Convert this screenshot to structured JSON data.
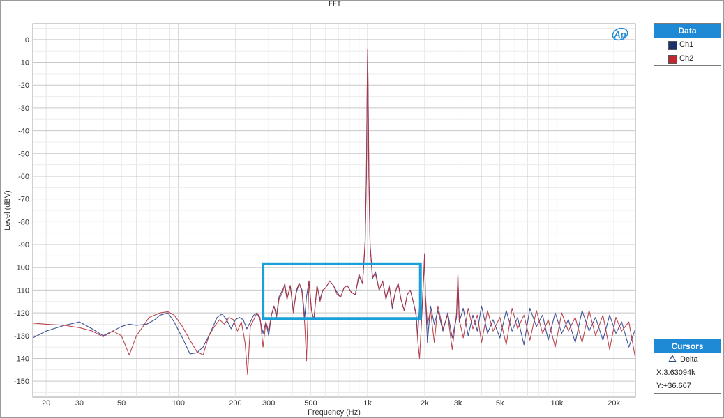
{
  "chart_data": {
    "type": "line",
    "title": "FFT",
    "xlabel": "Frequency (Hz)",
    "ylabel": "Level (dBV)",
    "xscale": "log",
    "xlim": [
      17,
      26000
    ],
    "ylim": [
      -157,
      7
    ],
    "grid": true,
    "x_tick_labels": [
      "20",
      "30",
      "50",
      "100",
      "200",
      "300",
      "500",
      "1k",
      "2k",
      "3k",
      "5k",
      "10k",
      "20k"
    ],
    "x_tick_values": [
      20,
      30,
      50,
      100,
      200,
      300,
      500,
      1000,
      2000,
      3000,
      5000,
      10000,
      20000
    ],
    "y_tick_values": [
      0,
      -10,
      -20,
      -30,
      -40,
      -50,
      -60,
      -70,
      -80,
      -90,
      -100,
      -110,
      -120,
      -130,
      -140,
      -150
    ],
    "series": [
      {
        "name": "Ch1",
        "color": "#2b3f8c",
        "points": [
          [
            17,
            -131
          ],
          [
            20,
            -128
          ],
          [
            25,
            -125.5
          ],
          [
            30,
            -124
          ],
          [
            35,
            -127
          ],
          [
            40,
            -130
          ],
          [
            45,
            -128
          ],
          [
            50,
            -126
          ],
          [
            55,
            -125
          ],
          [
            60,
            -125.5
          ],
          [
            68,
            -125
          ],
          [
            75,
            -123
          ],
          [
            80,
            -121
          ],
          [
            88,
            -120
          ],
          [
            95,
            -124
          ],
          [
            105,
            -131
          ],
          [
            115,
            -138
          ],
          [
            125,
            -137.5
          ],
          [
            135,
            -135
          ],
          [
            145,
            -130
          ],
          [
            160,
            -122
          ],
          [
            170,
            -120.5
          ],
          [
            180,
            -123
          ],
          [
            190,
            -127
          ],
          [
            200,
            -123
          ],
          [
            210,
            -122
          ],
          [
            220,
            -123
          ],
          [
            230,
            -127
          ],
          [
            240,
            -124
          ],
          [
            250,
            -121
          ],
          [
            260,
            -120
          ],
          [
            270,
            -123
          ],
          [
            280,
            -129
          ],
          [
            290,
            -124
          ],
          [
            300,
            -130
          ],
          [
            310,
            -121
          ],
          [
            320,
            -117
          ],
          [
            330,
            -121
          ],
          [
            340,
            -113
          ],
          [
            355,
            -110
          ],
          [
            365,
            -108
          ],
          [
            375,
            -114
          ],
          [
            390,
            -108
          ],
          [
            405,
            -119
          ],
          [
            420,
            -111
          ],
          [
            435,
            -107
          ],
          [
            450,
            -110
          ],
          [
            465,
            -122
          ],
          [
            475,
            -113
          ],
          [
            490,
            -106
          ],
          [
            505,
            -119
          ],
          [
            520,
            -123
          ],
          [
            540,
            -108
          ],
          [
            560,
            -114
          ],
          [
            580,
            -110
          ],
          [
            600,
            -109
          ],
          [
            630,
            -106
          ],
          [
            660,
            -108
          ],
          [
            690,
            -111
          ],
          [
            720,
            -113
          ],
          [
            750,
            -109
          ],
          [
            780,
            -108
          ],
          [
            820,
            -111
          ],
          [
            860,
            -112
          ],
          [
            900,
            -104
          ],
          [
            940,
            -107
          ],
          [
            970,
            -90
          ],
          [
            985,
            -60
          ],
          [
            995,
            -20
          ],
          [
            1000,
            -4.5
          ],
          [
            1005,
            -20
          ],
          [
            1015,
            -60
          ],
          [
            1030,
            -90
          ],
          [
            1060,
            -105
          ],
          [
            1100,
            -102
          ],
          [
            1150,
            -110
          ],
          [
            1200,
            -106
          ],
          [
            1250,
            -114
          ],
          [
            1300,
            -108
          ],
          [
            1350,
            -118
          ],
          [
            1400,
            -111
          ],
          [
            1450,
            -107
          ],
          [
            1500,
            -114
          ],
          [
            1560,
            -119
          ],
          [
            1620,
            -112
          ],
          [
            1680,
            -110
          ],
          [
            1740,
            -115
          ],
          [
            1800,
            -120
          ],
          [
            1840,
            -130
          ],
          [
            1880,
            -117
          ],
          [
            1920,
            -125
          ],
          [
            1980,
            -103
          ],
          [
            2000,
            -94
          ],
          [
            2020,
            -112
          ],
          [
            2070,
            -133
          ],
          [
            2150,
            -117
          ],
          [
            2250,
            -125
          ],
          [
            2350,
            -119
          ],
          [
            2500,
            -128
          ],
          [
            2650,
            -120
          ],
          [
            2800,
            -131
          ],
          [
            2950,
            -122
          ],
          [
            3000,
            -104
          ],
          [
            3050,
            -124
          ],
          [
            3200,
            -118
          ],
          [
            3400,
            -130
          ],
          [
            3600,
            -121
          ],
          [
            3800,
            -128
          ],
          [
            4000,
            -117
          ],
          [
            4300,
            -129
          ],
          [
            4600,
            -123
          ],
          [
            5000,
            -131
          ],
          [
            5400,
            -119
          ],
          [
            5800,
            -128
          ],
          [
            6200,
            -122
          ],
          [
            6700,
            -134
          ],
          [
            7200,
            -118
          ],
          [
            7800,
            -126
          ],
          [
            8400,
            -121
          ],
          [
            9000,
            -132
          ],
          [
            9800,
            -120
          ],
          [
            10600,
            -129
          ],
          [
            11500,
            -123
          ],
          [
            12500,
            -133
          ],
          [
            13600,
            -119
          ],
          [
            14800,
            -128
          ],
          [
            16000,
            -122
          ],
          [
            17500,
            -132
          ],
          [
            19000,
            -121
          ],
          [
            20500,
            -129
          ],
          [
            22000,
            -124
          ],
          [
            24000,
            -135
          ],
          [
            26000,
            -127
          ]
        ]
      },
      {
        "name": "Ch2",
        "color": "#b5323c",
        "points": [
          [
            17,
            -124.5
          ],
          [
            20,
            -125
          ],
          [
            25,
            -125.5
          ],
          [
            30,
            -126.5
          ],
          [
            35,
            -128
          ],
          [
            40,
            -130.5
          ],
          [
            45,
            -128
          ],
          [
            50,
            -130
          ],
          [
            55,
            -138.5
          ],
          [
            60,
            -130
          ],
          [
            65,
            -126
          ],
          [
            70,
            -122
          ],
          [
            75,
            -121
          ],
          [
            80,
            -120
          ],
          [
            88,
            -119.5
          ],
          [
            95,
            -121
          ],
          [
            105,
            -126
          ],
          [
            115,
            -132
          ],
          [
            125,
            -137
          ],
          [
            135,
            -138.5
          ],
          [
            145,
            -130
          ],
          [
            155,
            -126
          ],
          [
            165,
            -123
          ],
          [
            175,
            -125
          ],
          [
            185,
            -122
          ],
          [
            195,
            -123
          ],
          [
            205,
            -128
          ],
          [
            215,
            -124
          ],
          [
            225,
            -133
          ],
          [
            232,
            -147
          ],
          [
            240,
            -126
          ],
          [
            250,
            -123
          ],
          [
            260,
            -120
          ],
          [
            270,
            -122
          ],
          [
            280,
            -135
          ],
          [
            290,
            -124
          ],
          [
            300,
            -128
          ],
          [
            310,
            -121
          ],
          [
            320,
            -117
          ],
          [
            330,
            -122
          ],
          [
            340,
            -114
          ],
          [
            355,
            -111
          ],
          [
            365,
            -107
          ],
          [
            375,
            -114
          ],
          [
            390,
            -108
          ],
          [
            405,
            -120
          ],
          [
            420,
            -110
          ],
          [
            435,
            -107
          ],
          [
            450,
            -111
          ],
          [
            465,
            -125
          ],
          [
            475,
            -141
          ],
          [
            490,
            -106
          ],
          [
            505,
            -119
          ],
          [
            520,
            -123
          ],
          [
            540,
            -108
          ],
          [
            560,
            -115
          ],
          [
            580,
            -110
          ],
          [
            600,
            -109
          ],
          [
            630,
            -106
          ],
          [
            660,
            -108
          ],
          [
            690,
            -112
          ],
          [
            720,
            -113
          ],
          [
            750,
            -109
          ],
          [
            780,
            -108
          ],
          [
            820,
            -111
          ],
          [
            860,
            -112
          ],
          [
            900,
            -103
          ],
          [
            940,
            -107
          ],
          [
            970,
            -88
          ],
          [
            985,
            -60
          ],
          [
            995,
            -20
          ],
          [
            1000,
            -4.5
          ],
          [
            1005,
            -20
          ],
          [
            1015,
            -60
          ],
          [
            1030,
            -90
          ],
          [
            1060,
            -104
          ],
          [
            1100,
            -103
          ],
          [
            1150,
            -110
          ],
          [
            1200,
            -106
          ],
          [
            1250,
            -114
          ],
          [
            1300,
            -108
          ],
          [
            1350,
            -117
          ],
          [
            1400,
            -111
          ],
          [
            1450,
            -107
          ],
          [
            1500,
            -114
          ],
          [
            1560,
            -119
          ],
          [
            1620,
            -112
          ],
          [
            1680,
            -110
          ],
          [
            1740,
            -115
          ],
          [
            1800,
            -121
          ],
          [
            1840,
            -132
          ],
          [
            1880,
            -140
          ],
          [
            1920,
            -126
          ],
          [
            1980,
            -103
          ],
          [
            2000,
            -94
          ],
          [
            2020,
            -112
          ],
          [
            2070,
            -125
          ],
          [
            2150,
            -119
          ],
          [
            2250,
            -133
          ],
          [
            2350,
            -117
          ],
          [
            2500,
            -127
          ],
          [
            2650,
            -121
          ],
          [
            2800,
            -136
          ],
          [
            2950,
            -120
          ],
          [
            3000,
            -103
          ],
          [
            3050,
            -123
          ],
          [
            3200,
            -131
          ],
          [
            3400,
            -118
          ],
          [
            3600,
            -127
          ],
          [
            3800,
            -121
          ],
          [
            4000,
            -133
          ],
          [
            4300,
            -119
          ],
          [
            4600,
            -128
          ],
          [
            5000,
            -122
          ],
          [
            5400,
            -134
          ],
          [
            5800,
            -118
          ],
          [
            6200,
            -127
          ],
          [
            6700,
            -121
          ],
          [
            7200,
            -132
          ],
          [
            7800,
            -119
          ],
          [
            8400,
            -129
          ],
          [
            9000,
            -123
          ],
          [
            9800,
            -135
          ],
          [
            10600,
            -120
          ],
          [
            11500,
            -128
          ],
          [
            12500,
            -122
          ],
          [
            13600,
            -133
          ],
          [
            14800,
            -119
          ],
          [
            16000,
            -130
          ],
          [
            17500,
            -121
          ],
          [
            19000,
            -136
          ],
          [
            20500,
            -122
          ],
          [
            22000,
            -128
          ],
          [
            24000,
            -124
          ],
          [
            26000,
            -140
          ]
        ]
      }
    ],
    "highlight_box": {
      "x_range": [
        280,
        1900
      ],
      "y_range": [
        -122.5,
        -98.5
      ],
      "color": "#1aa0d8"
    },
    "logo": "Ap"
  },
  "legend": {
    "header": "Data",
    "items": [
      {
        "label": "Ch1",
        "color": "#1c2f6e"
      },
      {
        "label": "Ch2",
        "color": "#c0282f"
      }
    ]
  },
  "cursors": {
    "header": "Cursors",
    "mode": "Delta",
    "x_readout": "X:3.63094k",
    "y_readout": "Y:+36.667"
  }
}
